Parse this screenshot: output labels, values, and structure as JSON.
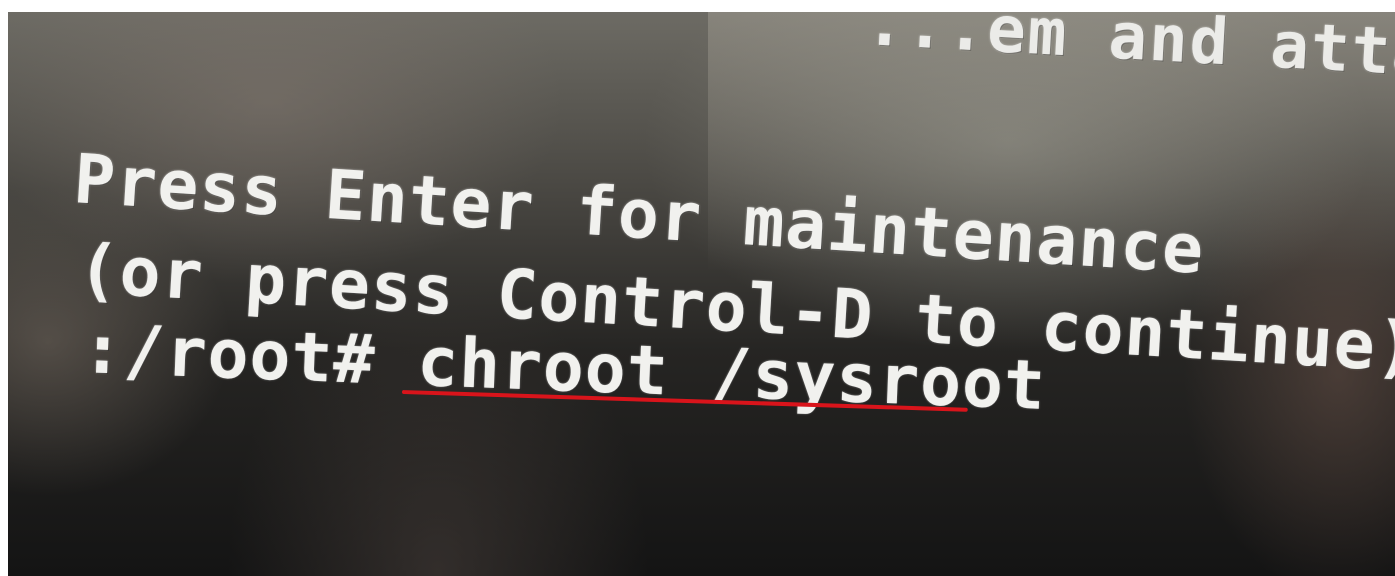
{
  "terminal": {
    "line_top": "...em and attach it to",
    "line_prompt_1": "Press Enter for maintenance",
    "line_prompt_2": "(or press Control-D to continue):",
    "shell_prompt": ":/root#",
    "command": "chroot /sysroot"
  },
  "annotation": {
    "underline_color": "#d9141b"
  }
}
